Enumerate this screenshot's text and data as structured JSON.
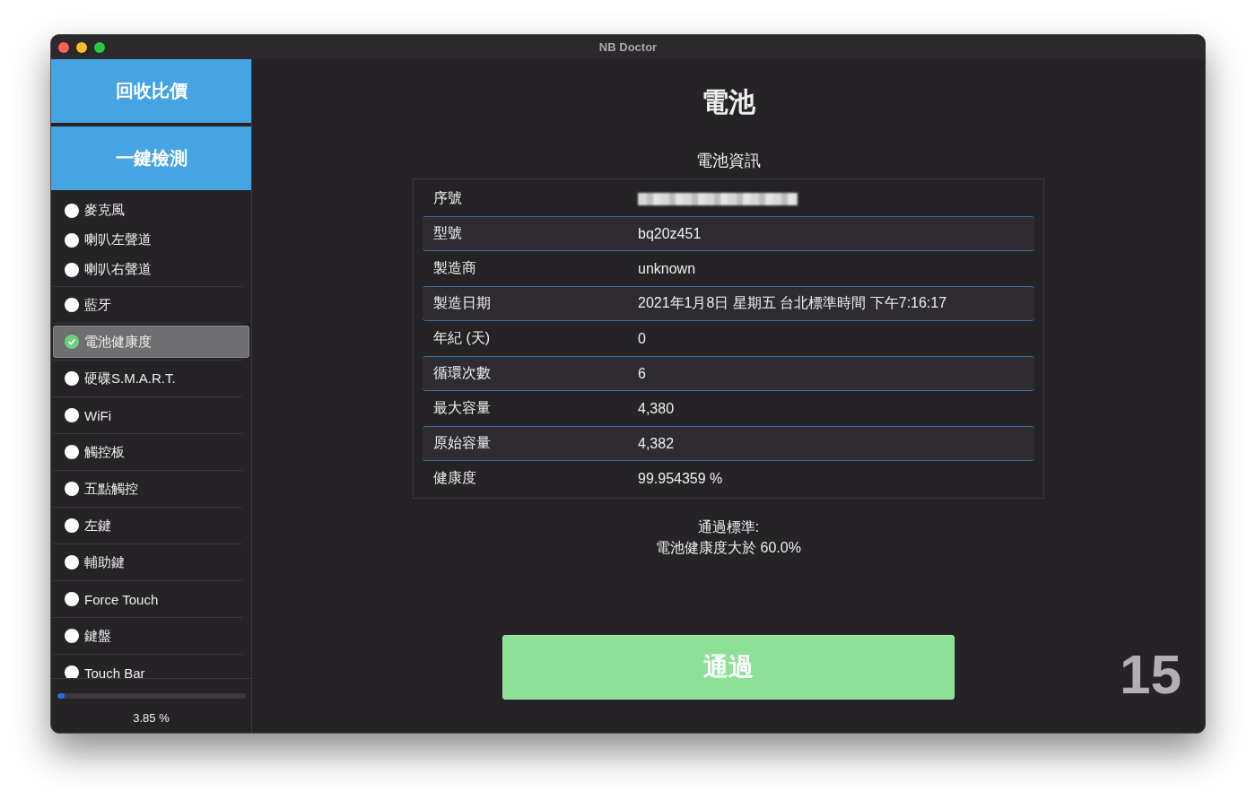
{
  "window": {
    "title": "NB Doctor"
  },
  "sidebar": {
    "buttons": [
      "回收比價",
      "一鍵檢測"
    ],
    "groups": [
      {
        "items": [
          {
            "label": "麥克風",
            "selected": false,
            "passed": false
          },
          {
            "label": "喇叭左聲道",
            "selected": false,
            "passed": false
          },
          {
            "label": "喇叭右聲道",
            "selected": false,
            "passed": false
          }
        ]
      },
      {
        "items": [
          {
            "label": "藍牙",
            "selected": false,
            "passed": false
          }
        ]
      },
      {
        "items": [
          {
            "label": "電池健康度",
            "selected": true,
            "passed": true
          }
        ]
      },
      {
        "items": [
          {
            "label": "硬碟S.M.A.R.T.",
            "selected": false,
            "passed": false
          }
        ]
      },
      {
        "items": [
          {
            "label": "WiFi",
            "selected": false,
            "passed": false
          }
        ]
      },
      {
        "items": [
          {
            "label": "觸控板",
            "selected": false,
            "passed": false
          }
        ]
      },
      {
        "items": [
          {
            "label": "五點觸控",
            "selected": false,
            "passed": false
          }
        ]
      },
      {
        "items": [
          {
            "label": "左鍵",
            "selected": false,
            "passed": false
          }
        ]
      },
      {
        "items": [
          {
            "label": "輔助鍵",
            "selected": false,
            "passed": false
          }
        ]
      },
      {
        "items": [
          {
            "label": "Force Touch",
            "selected": false,
            "passed": false
          }
        ]
      },
      {
        "items": [
          {
            "label": "鍵盤",
            "selected": false,
            "passed": false
          }
        ]
      },
      {
        "items": [
          {
            "label": "Touch Bar",
            "selected": false,
            "passed": false
          }
        ]
      }
    ],
    "progress": {
      "level": 0.0385,
      "reading": "3.85 %"
    }
  },
  "main": {
    "title": "電池",
    "section_title": "電池資訊",
    "rows": [
      {
        "label": "序號",
        "redacted": true
      },
      {
        "label": "型號",
        "value": "bq20z451",
        "redacted": false
      },
      {
        "label": "製造商",
        "value": "unknown",
        "redacted": false
      },
      {
        "label": "製造日期",
        "value": "2021年1月8日 星期五 台北標準時間 下午7:16:17",
        "redacted": false
      },
      {
        "label": "年紀 (天)",
        "value": "0",
        "redacted": false
      },
      {
        "label": "循環次數",
        "value": "6",
        "redacted": false
      },
      {
        "label": "最大容量",
        "value": "4,380",
        "redacted": false
      },
      {
        "label": "原始容量",
        "value": "4,382",
        "redacted": false
      },
      {
        "label": "健康度",
        "value": "99.954359 %",
        "redacted": false
      }
    ],
    "criteria": [
      "通過標準:",
      "電池健康度大於 60.0%"
    ],
    "result_button": "通過",
    "counter": "15"
  }
}
